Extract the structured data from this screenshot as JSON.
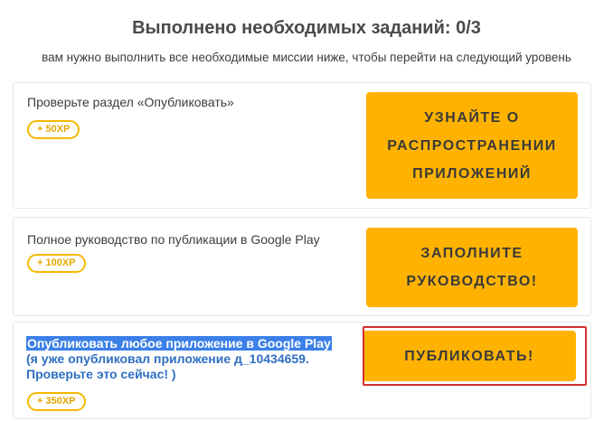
{
  "header": {
    "progress_text": "Выполнено необходимых заданий: 0/3",
    "instruction": "вам нужно выполнить все необходимые миссии ниже, чтобы перейти на следующий уровень"
  },
  "missions": [
    {
      "title": "Проверьте раздел «Опубликовать»",
      "xp": "+ 50XP",
      "button": "УЗНАЙТЕ О РАСПРОСТРАНЕНИИ ПРИЛОЖЕНИЙ"
    },
    {
      "title": "Полное руководство по публикации в Google Play",
      "xp": "+ 100XP",
      "button": "ЗАПОЛНИТЕ РУКОВОДСТВО!"
    },
    {
      "title": "Опубликовать любое приложение в Google Play",
      "note": "(я уже опубликовал приложение д_10434659. Проверьте это сейчас! )",
      "xp": "+ 350XP",
      "button": "ПУБЛИКОВАТЬ!"
    }
  ],
  "colors": {
    "button_bg": "#ffb300",
    "xp_border": "#f5b800",
    "selection_highlight": "#3b80e8",
    "note_text": "#2f6fc2",
    "focus_ring": "#d32f2f"
  }
}
